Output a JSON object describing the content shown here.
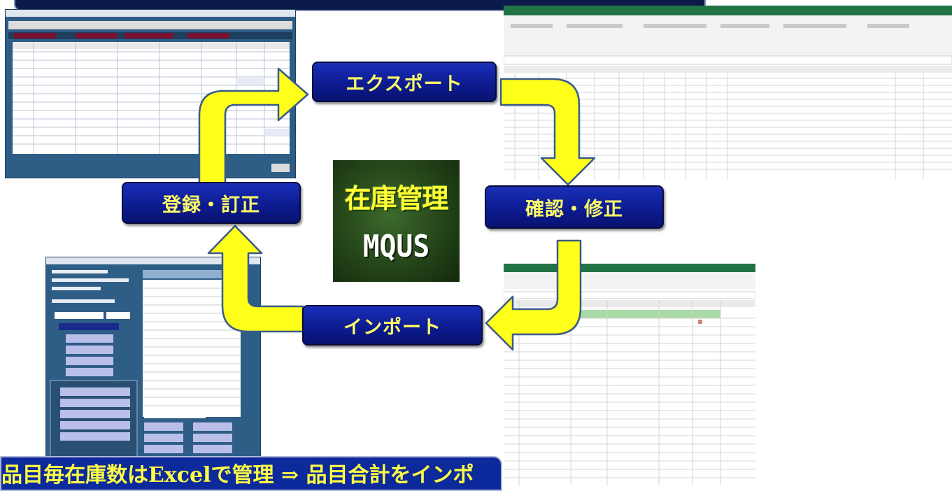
{
  "steps": {
    "export": "エクスポート",
    "confirm": "確認・修正",
    "import": "インポート",
    "register": "登録・訂正"
  },
  "logo": {
    "title": "在庫管理",
    "subtitle": "MQUS"
  },
  "banner": {
    "text": "品目毎在庫数はExcelで管理 ⇒ 品目合計をインポ"
  },
  "colors": {
    "step_bg": "#0c1a8e",
    "step_text": "#ffff66",
    "arrow_fill": "#ffff1a",
    "arrow_stroke": "#3a5a8a",
    "banner_bg": "#0d2a9c"
  },
  "icons": [
    "arrow-up-right-icon",
    "arrow-right-down-icon",
    "arrow-down-left-icon",
    "arrow-left-up-icon"
  ]
}
